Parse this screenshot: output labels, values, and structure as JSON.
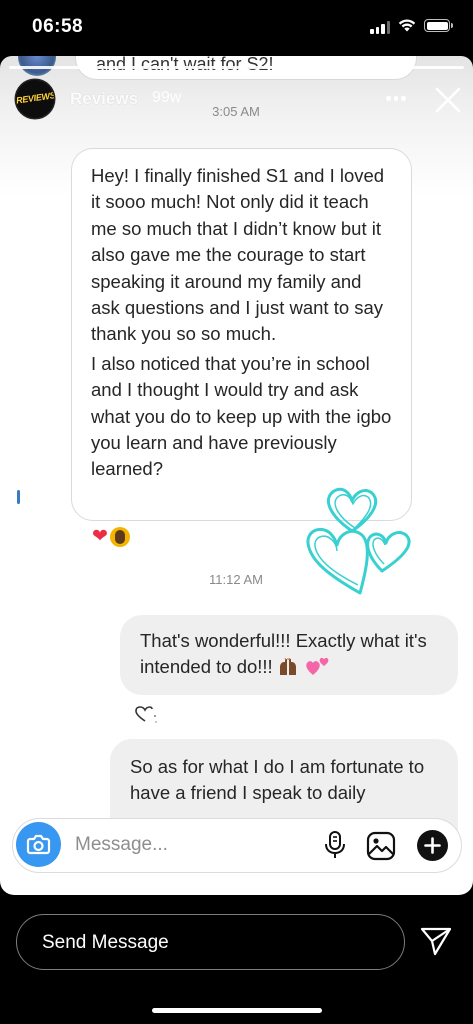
{
  "status_bar": {
    "time": "06:58"
  },
  "story": {
    "username": "Reviews",
    "age": "99w",
    "avatar_label": "REVIEWS",
    "previous_message_partial": "and I can't wait for S2!"
  },
  "conversation": {
    "timestamps": [
      "3:05 AM",
      "11:12 AM"
    ],
    "incoming_message": {
      "paragraphs": [
        "Hey! I finally finished S1 and I loved it sooo much! Not only did it teach me so much that I didn’t know but it also gave me the courage to start speaking it around my family and ask questions and I just want to say thank you so so much.",
        "I also noticed that you’re in school and I thought I would try and ask what you do to keep up with the igbo you learn and have previously learned?"
      ],
      "reactions": [
        "red-heart",
        "person-face"
      ]
    },
    "outgoing_messages": [
      {
        "text": "That's wonderful!!! Exactly what it's intended to do!!!",
        "emojis": [
          "raised-hands",
          "two-hearts"
        ]
      },
      {
        "text": "So as for what I do I am fortunate to have a friend I speak to daily"
      }
    ]
  },
  "composer": {
    "placeholder": "Message..."
  },
  "reply": {
    "label": "Send Message"
  },
  "colors": {
    "accent_blue": "#3897f0",
    "doodle_teal": "#38d0d0",
    "reaction_red": "#ed2d45"
  }
}
